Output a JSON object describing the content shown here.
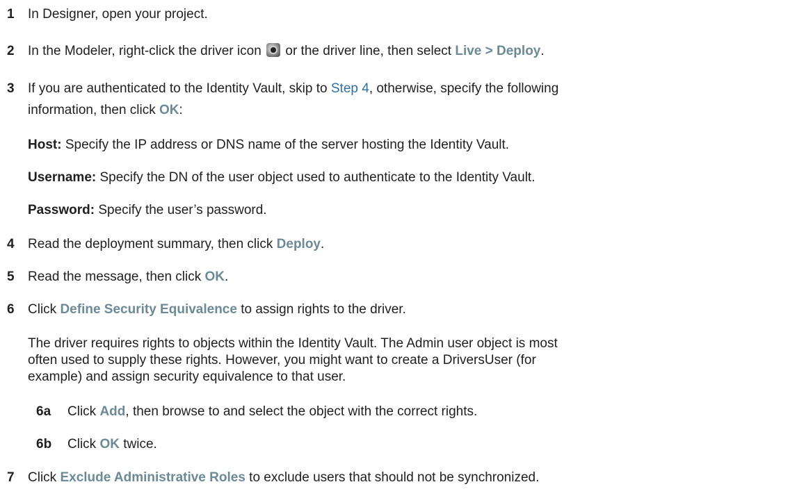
{
  "steps": {
    "s1": {
      "num": "1",
      "text": "In Designer, open your project."
    },
    "s2": {
      "num": "2",
      "pre": "In the Modeler, right-click the driver icon",
      "mid": "or the driver line, then select",
      "ui": "Live > Deploy",
      "post": "."
    },
    "s3": {
      "num": "3",
      "pre": "If you are authenticated to the Identity Vault, skip to",
      "link": "Step 4",
      "mid": ", otherwise, specify the following",
      "line2_pre": "information, then click",
      "ui": "OK",
      "post": ":",
      "host_label": "Host:",
      "host_text": "Specify the IP address or DNS name of the server hosting the Identity Vault.",
      "username_label": "Username:",
      "username_text": "Specify the DN of the user object used to authenticate to the Identity Vault.",
      "password_label": "Password:",
      "password_text": "Specify the user’s password."
    },
    "s4": {
      "num": "4",
      "pre": "Read the deployment summary, then click",
      "ui": "Deploy",
      "post": "."
    },
    "s5": {
      "num": "5",
      "pre": "Read the message, then click",
      "ui": "OK",
      "post": "."
    },
    "s6": {
      "num": "6",
      "pre": "Click",
      "ui": "Define Security Equivalence",
      "post": "to assign rights to the driver.",
      "para_line1": "The driver requires rights to objects within the Identity Vault. The Admin user object is most",
      "para_line2": "often used to supply these rights. However, you might want to create a DriversUser (for",
      "para_line3": "example) and assign security equivalence to that user.",
      "sub_a": {
        "num": "6a",
        "pre": "Click",
        "ui": "Add",
        "post": ", then browse to and select the object with the correct rights."
      },
      "sub_b": {
        "num": "6b",
        "pre": "Click",
        "ui": "OK",
        "post": "twice."
      }
    },
    "s7": {
      "num": "7",
      "pre": "Click",
      "ui": "Exclude Administrative Roles",
      "post": "to exclude users that should not be synchronized."
    }
  },
  "icons": {
    "driver": "driver-icon"
  }
}
